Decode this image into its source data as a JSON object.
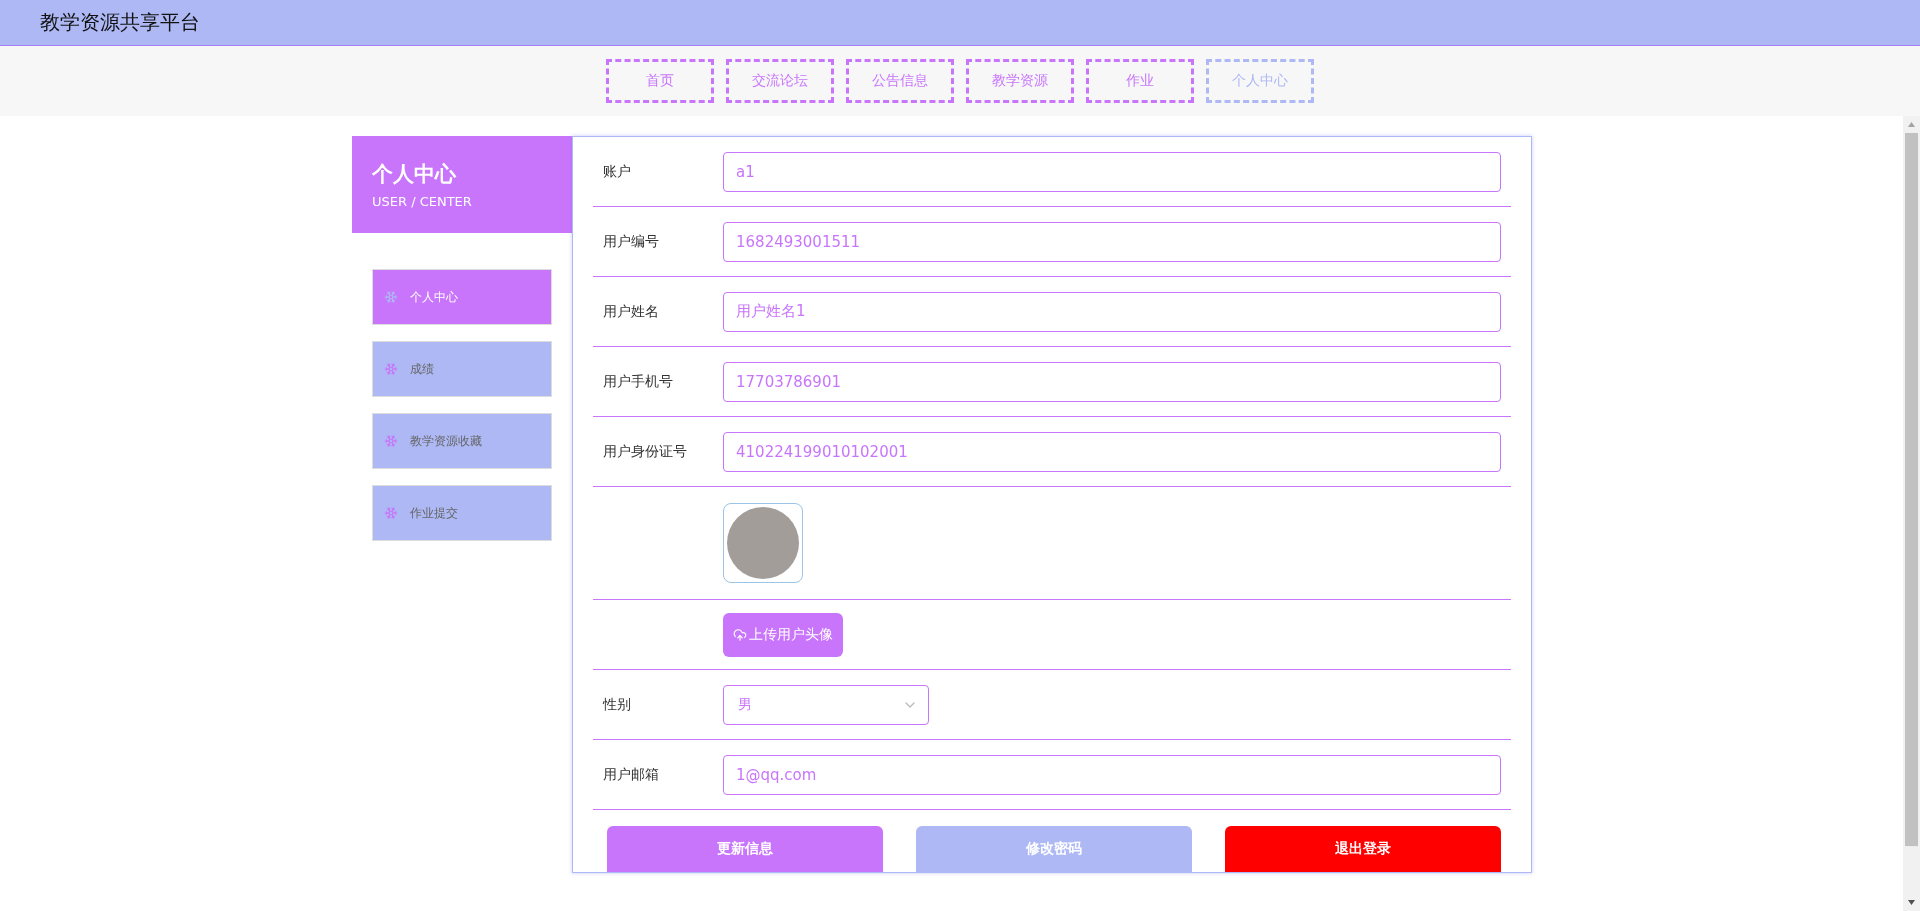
{
  "header": {
    "title": "教学资源共享平台"
  },
  "nav": [
    {
      "label": "首页",
      "selected": false
    },
    {
      "label": "交流论坛",
      "selected": false
    },
    {
      "label": "公告信息",
      "selected": false
    },
    {
      "label": "教学资源",
      "selected": false
    },
    {
      "label": "作业",
      "selected": false
    },
    {
      "label": "个人中心",
      "selected": true
    }
  ],
  "sidebar": {
    "title": "个人中心",
    "subtitle": "USER / CENTER",
    "items": [
      {
        "label": "个人中心",
        "selected": true
      },
      {
        "label": "成绩",
        "selected": false
      },
      {
        "label": "教学资源收藏",
        "selected": false
      },
      {
        "label": "作业提交",
        "selected": false
      }
    ]
  },
  "form": {
    "fields": [
      {
        "kind": "text",
        "label": "账户",
        "value": "a1"
      },
      {
        "kind": "text",
        "label": "用户编号",
        "value": "1682493001511"
      },
      {
        "kind": "text",
        "label": "用户姓名",
        "value": "用户姓名1"
      },
      {
        "kind": "text",
        "label": "用户手机号",
        "value": "17703786901"
      },
      {
        "kind": "text",
        "label": "用户身份证号",
        "value": "410224199010102001"
      },
      {
        "kind": "avatar"
      },
      {
        "kind": "upload",
        "button": "上传用户头像"
      },
      {
        "kind": "select",
        "label": "性别",
        "value": "男"
      },
      {
        "kind": "text",
        "label": "用户邮箱",
        "value": "1@qq.com"
      }
    ],
    "buttons": [
      {
        "kind": "primary",
        "label": "更新信息"
      },
      {
        "kind": "secondary",
        "label": "修改密码"
      },
      {
        "kind": "danger",
        "label": "退出登录"
      }
    ]
  }
}
